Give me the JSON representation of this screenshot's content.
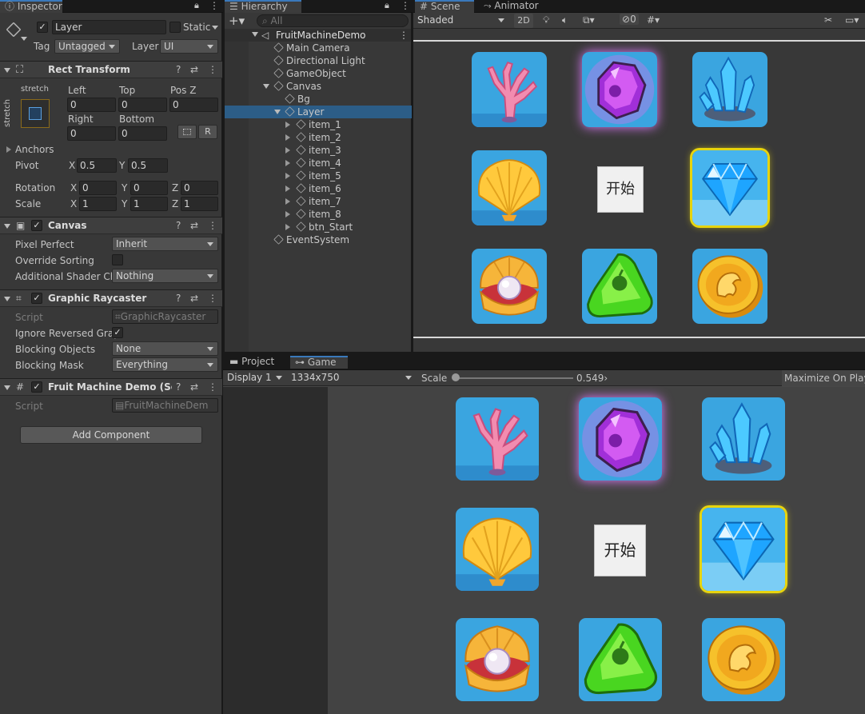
{
  "inspector": {
    "tab": "Inspector",
    "object_name": "Layer",
    "static_label": "Static",
    "tag_label": "Tag",
    "tag_value": "Untagged",
    "layer_label": "Layer",
    "layer_value": "UI",
    "rect_transform": {
      "title": "Rect Transform",
      "anchor_preset_top": "stretch",
      "anchor_preset_side": "stretch",
      "left_label": "Left",
      "left": "0",
      "top_label": "Top",
      "top": "0",
      "posz_label": "Pos Z",
      "posz": "0",
      "right_label": "Right",
      "right": "0",
      "bottom_label": "Bottom",
      "bottom": "0",
      "r_button": "R",
      "anchors_label": "Anchors",
      "pivot_label": "Pivot",
      "pivot_x": "0.5",
      "pivot_y": "0.5",
      "rotation_label": "Rotation",
      "rot_x": "0",
      "rot_y": "0",
      "rot_z": "0",
      "scale_label": "Scale",
      "scale_x": "1",
      "scale_y": "1",
      "scale_z": "1",
      "x": "X",
      "y": "Y",
      "z": "Z"
    },
    "canvas": {
      "title": "Canvas",
      "pixel_perfect_label": "Pixel Perfect",
      "pixel_perfect": "Inherit",
      "override_sorting_label": "Override Sorting",
      "additional_shader_label": "Additional Shader Ch",
      "additional_shader": "Nothing"
    },
    "graphic_raycaster": {
      "title": "Graphic Raycaster",
      "script_label": "Script",
      "script_value": "GraphicRaycaster",
      "ignore_reversed_label": "Ignore Reversed Grap",
      "blocking_objects_label": "Blocking Objects",
      "blocking_objects": "None",
      "blocking_mask_label": "Blocking Mask",
      "blocking_mask": "Everything"
    },
    "fruit_machine": {
      "title": "Fruit Machine Demo (Scrip",
      "script_label": "Script",
      "script_value": "FruitMachineDem"
    },
    "add_component": "Add Component"
  },
  "hierarchy": {
    "tab": "Hierarchy",
    "search_placeholder": "All",
    "scene": "FruitMachineDemo",
    "items": [
      {
        "label": "Main Camera"
      },
      {
        "label": "Directional Light"
      },
      {
        "label": "GameObject"
      },
      {
        "label": "Canvas"
      },
      {
        "label": "Bg"
      },
      {
        "label": "Layer"
      },
      {
        "label": "item_1"
      },
      {
        "label": "item_2"
      },
      {
        "label": "item_3"
      },
      {
        "label": "item_4"
      },
      {
        "label": "item_5"
      },
      {
        "label": "item_6"
      },
      {
        "label": "item_7"
      },
      {
        "label": "item_8"
      },
      {
        "label": "btn_Start"
      },
      {
        "label": "EventSystem"
      }
    ]
  },
  "scene": {
    "tab_scene": "Scene",
    "tab_animator": "Animator",
    "shading": "Shaded",
    "mode_2d": "2D",
    "hidden_count": "0"
  },
  "game": {
    "tab_project": "Project",
    "tab_game": "Game",
    "display": "Display 1",
    "resolution": "1334x750",
    "scale_label": "Scale",
    "scale_value": "0.549›",
    "maximize": "Maximize On Play",
    "start_button": "开始"
  },
  "slots": [
    "coral",
    "amethyst",
    "crystal",
    "shell",
    "diamond",
    "pearl",
    "gem-green",
    "coin"
  ],
  "colors": {
    "selected_row": "#2c5d87",
    "active_tab_accent": "#3a79bb",
    "slot_bg": "#3aa5e0",
    "highlight_border": "#e7d40e"
  }
}
